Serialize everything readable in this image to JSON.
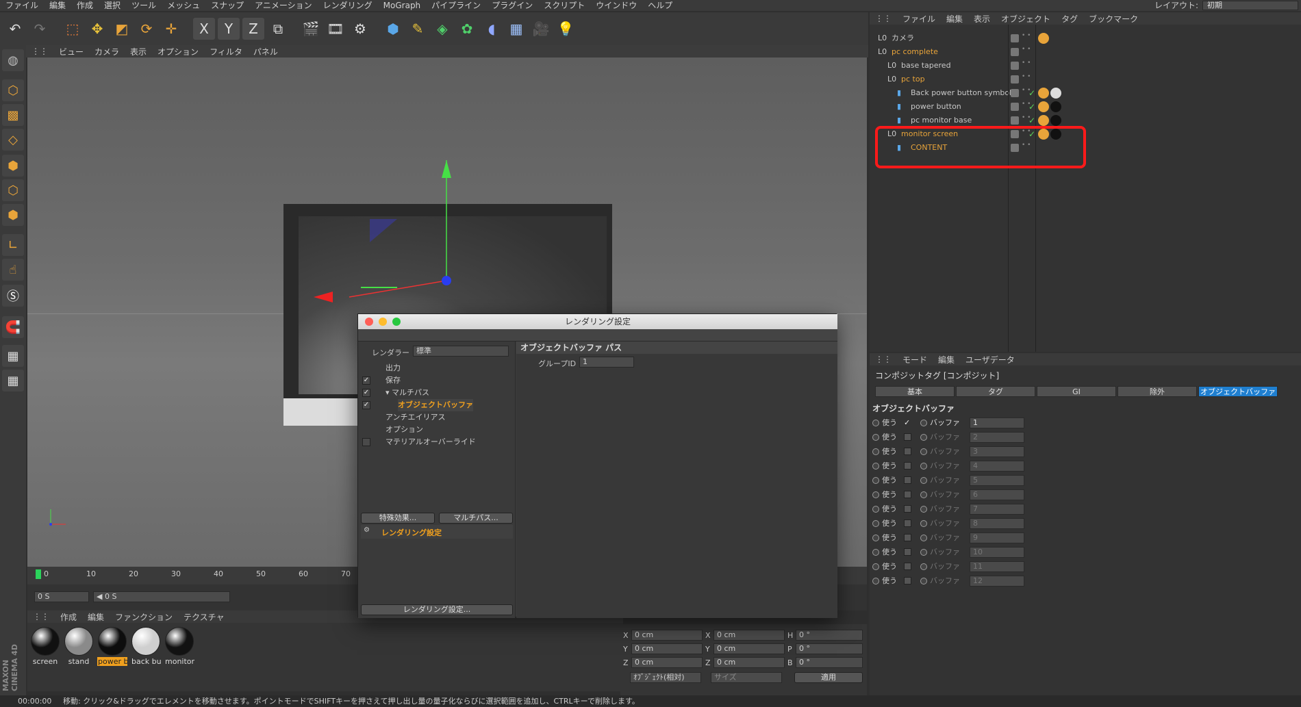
{
  "menubar": {
    "items": [
      "ファイル",
      "編集",
      "作成",
      "選択",
      "ツール",
      "メッシュ",
      "スナップ",
      "アニメーション",
      "レンダリング",
      "MoGraph",
      "パイプライン",
      "プラグイン",
      "スクリプト",
      "ウインドウ",
      "ヘルプ"
    ],
    "layout_label": "レイアウト:",
    "layout_value": "初期"
  },
  "toolbar": {
    "icons": [
      "undo-icon",
      "redo-icon",
      "select-icon",
      "move-icon",
      "scale-icon",
      "rotate-icon",
      "add-icon",
      "x-axis-icon",
      "y-axis-icon",
      "z-axis-icon",
      "coord-icon",
      "render-view-icon",
      "render-picture-icon",
      "render-settings-icon",
      "cube-icon",
      "pen-icon",
      "subdivision-icon",
      "cloner-icon",
      "deformer-icon",
      "floor-icon",
      "camera-icon",
      "light-icon"
    ],
    "axis_labels": [
      "X",
      "Y",
      "Z"
    ]
  },
  "viewport": {
    "menu": [
      "ビュー",
      "カメラ",
      "表示",
      "オプション",
      "フィルタ",
      "パネル"
    ]
  },
  "timeline": {
    "ticks": [
      "0",
      "10",
      "20",
      "30",
      "40",
      "50",
      "60",
      "70"
    ],
    "start_field": "0 S",
    "current_field": "◀ 0 S"
  },
  "materials": {
    "menu": [
      "作成",
      "編集",
      "ファンクション",
      "テクスチャ"
    ],
    "items": [
      {
        "label": "screen",
        "color": "#111111"
      },
      {
        "label": "stand",
        "color": "#8a8a8a"
      },
      {
        "label": "power b",
        "color": "#0d0d0d"
      },
      {
        "label": "back bu",
        "color": "#cfcfcf"
      },
      {
        "label": "monitor",
        "color": "#121212"
      }
    ],
    "brand": "MAXON CINEMA 4D"
  },
  "coords": {
    "rows": [
      {
        "axis": "X",
        "pos": "0 cm",
        "axis2": "X",
        "size": "0 cm",
        "rot_label": "H",
        "rot": "0 °"
      },
      {
        "axis": "Y",
        "pos": "0 cm",
        "axis2": "Y",
        "size": "0 cm",
        "rot_label": "P",
        "rot": "0 °"
      },
      {
        "axis": "Z",
        "pos": "0 cm",
        "axis2": "Z",
        "size": "0 cm",
        "rot_label": "B",
        "rot": "0 °"
      }
    ],
    "mode_select": "ｵﾌﾞｼﾞｪｸﾄ(相対)",
    "size_select": "サイズ",
    "apply": "適用"
  },
  "objmgr": {
    "menu": [
      "ファイル",
      "編集",
      "表示",
      "オブジェクト",
      "タグ",
      "ブックマーク"
    ],
    "rows": [
      {
        "name": "カメラ",
        "indent": 0,
        "orange": false,
        "check": false
      },
      {
        "name": "pc complete",
        "indent": 0,
        "orange": true,
        "check": false
      },
      {
        "name": "base tapered",
        "indent": 1,
        "orange": false,
        "check": false
      },
      {
        "name": "pc top",
        "indent": 1,
        "orange": true,
        "check": false
      },
      {
        "name": "Back power button symbol",
        "indent": 2,
        "orange": false,
        "check": true
      },
      {
        "name": "power button",
        "indent": 2,
        "orange": false,
        "check": true
      },
      {
        "name": "pc monitor base",
        "indent": 2,
        "orange": false,
        "check": true
      },
      {
        "name": "monitor screen",
        "indent": 1,
        "orange": true,
        "check": true
      },
      {
        "name": "CONTENT",
        "indent": 2,
        "orange": true,
        "check": false
      }
    ]
  },
  "attr": {
    "menu": [
      "モード",
      "編集",
      "ユーザデータ"
    ],
    "title": "コンポジットタグ [コンポジット]",
    "tabs": [
      "基本",
      "タグ",
      "GI",
      "除外",
      "オブジェクトバッファ"
    ],
    "active_tab": 4,
    "section": "オブジェクトバッファ",
    "use_label": "使う",
    "buffer_label": "バッファ",
    "buffers": [
      "1",
      "2",
      "3",
      "4",
      "5",
      "6",
      "7",
      "8",
      "9",
      "10",
      "11",
      "12"
    ]
  },
  "dialog": {
    "title": "レンダリング設定",
    "renderer_label": "レンダラー",
    "renderer_value": "標準",
    "tree": [
      {
        "label": "出力",
        "check": null,
        "indent": 0,
        "sel": false
      },
      {
        "label": "保存",
        "check": true,
        "indent": 0,
        "sel": false
      },
      {
        "label": "▾ マルチパス",
        "check": true,
        "indent": 0,
        "sel": false
      },
      {
        "label": "オブジェクトバッファ",
        "check": true,
        "indent": 1,
        "sel": true
      },
      {
        "label": "アンチエイリアス",
        "check": null,
        "indent": 0,
        "sel": false
      },
      {
        "label": "オプション",
        "check": null,
        "indent": 0,
        "sel": false
      },
      {
        "label": "マテリアルオーバーライド",
        "check": false,
        "indent": 0,
        "sel": false
      }
    ],
    "btn_effects": "特殊効果...",
    "btn_multipass": "マルチパス...",
    "preset": "レンダリング設定",
    "btn_settings": "レンダリング設定...",
    "right_title": "オブジェクトバッファ パス",
    "group_label": "グループID",
    "group_value": "1"
  },
  "status": {
    "time": "00:00:00",
    "message": "移動: クリック&ドラッグでエレメントを移動させます。ポイントモードでSHIFTキーを押さえて押し出し量の量子化ならびに選択範囲を追加し、CTRLキーで削除します。"
  }
}
